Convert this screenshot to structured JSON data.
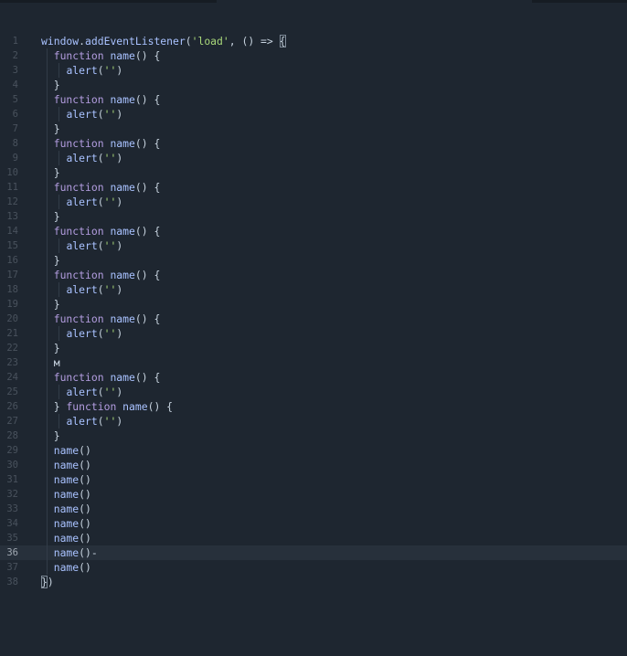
{
  "editor": {
    "lines": [
      {
        "number": "1",
        "text": "window.addEventListener('load', () => {"
      },
      {
        "number": "2",
        "text": "  function name() {"
      },
      {
        "number": "3",
        "text": "    alert('')"
      },
      {
        "number": "4",
        "text": "  }"
      },
      {
        "number": "5",
        "text": "  function name() {"
      },
      {
        "number": "6",
        "text": "    alert('')"
      },
      {
        "number": "7",
        "text": "  }"
      },
      {
        "number": "8",
        "text": "  function name() {"
      },
      {
        "number": "9",
        "text": "    alert('')"
      },
      {
        "number": "10",
        "text": "  }"
      },
      {
        "number": "11",
        "text": "  function name() {"
      },
      {
        "number": "12",
        "text": "    alert('')"
      },
      {
        "number": "13",
        "text": "  }"
      },
      {
        "number": "14",
        "text": "  function name() {"
      },
      {
        "number": "15",
        "text": "    alert('')"
      },
      {
        "number": "16",
        "text": "  }"
      },
      {
        "number": "17",
        "text": "  function name() {"
      },
      {
        "number": "18",
        "text": "    alert('')"
      },
      {
        "number": "19",
        "text": "  }"
      },
      {
        "number": "20",
        "text": "  function name() {"
      },
      {
        "number": "21",
        "text": "    alert('')"
      },
      {
        "number": "22",
        "text": "  }"
      },
      {
        "number": "23",
        "text": "  м"
      },
      {
        "number": "24",
        "text": "  function name() {"
      },
      {
        "number": "25",
        "text": "    alert('')"
      },
      {
        "number": "26",
        "text": "  } function name() {"
      },
      {
        "number": "27",
        "text": "    alert('')"
      },
      {
        "number": "28",
        "text": "  }"
      },
      {
        "number": "29",
        "text": "  name()"
      },
      {
        "number": "30",
        "text": "  name()"
      },
      {
        "number": "31",
        "text": "  name()"
      },
      {
        "number": "32",
        "text": "  name()"
      },
      {
        "number": "33",
        "text": "  name()"
      },
      {
        "number": "34",
        "text": "  name()"
      },
      {
        "number": "35",
        "text": "  name()"
      },
      {
        "number": "36",
        "text": "  name()-"
      },
      {
        "number": "37",
        "text": "  name()"
      },
      {
        "number": "38",
        "text": "})"
      }
    ],
    "current_line": "36",
    "colors": {
      "background": "#1e2630",
      "current_line": "#27303b",
      "keyword": "#b39de0",
      "function": "#a9c2ff",
      "string": "#a9d87a",
      "gutter": "#49525d"
    }
  }
}
